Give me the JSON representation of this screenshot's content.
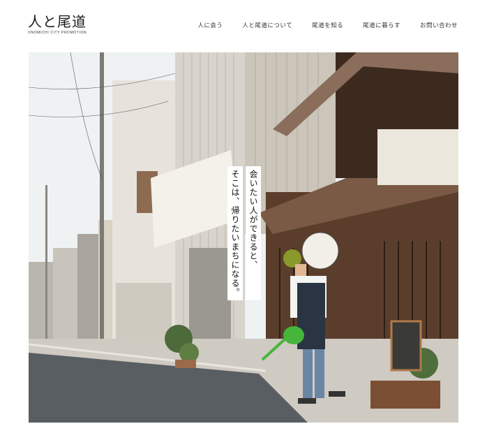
{
  "brand": {
    "title": "人と尾道",
    "subtitle": "ONOMICHI CITY PROMOTION"
  },
  "nav": {
    "items": [
      {
        "label": "人に会う"
      },
      {
        "label": "人と尾道について"
      },
      {
        "label": "尾道を知る"
      },
      {
        "label": "尾道に暮らす"
      },
      {
        "label": "お問い合わせ"
      }
    ]
  },
  "hero": {
    "tagline": [
      "会いたい人ができると、",
      "そこは、帰りたいまちになる。"
    ],
    "photo_description_icon": "photo-icon"
  },
  "colors": {
    "sky": "#eef2f3",
    "street": "#595e63",
    "sidewalk": "#cfcac2",
    "wood": "#5a3e2b",
    "apron": "#2a3442",
    "watering_can": "#46b53c"
  }
}
